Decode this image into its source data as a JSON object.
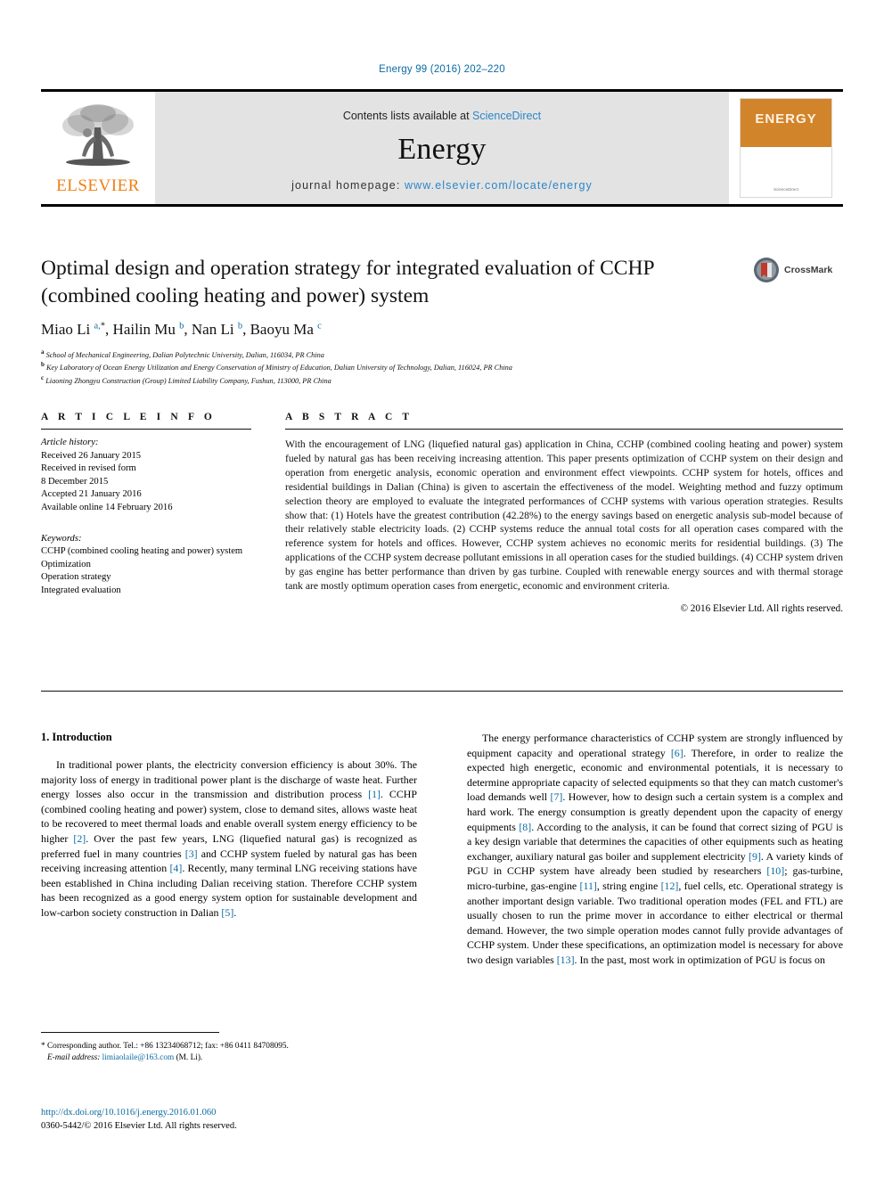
{
  "running_head": "Energy 99 (2016) 202–220",
  "masthead": {
    "contents_prefix": "Contents lists available at ",
    "sciencedirect": "ScienceDirect",
    "journal_name": "Energy",
    "homepage_prefix": "journal homepage: ",
    "homepage_url": "www.elsevier.com/locate/energy",
    "publisher_logo_text": "ELSEVIER",
    "cover_title": "ENERGY",
    "cover_footer": "ScienceDirect",
    "accent_blue": "#2a87c8",
    "elsevier_orange": "#f07f13",
    "cover_orange": "#d2842a"
  },
  "article": {
    "title": "Optimal design and operation strategy for integrated evaluation of CCHP (combined cooling heating and power) system",
    "crossmark_label": "CrossMark",
    "authors_html": "Miao Li <sup>a,</sup><sup class=\"star\">*</sup>, Hailin Mu <sup>b</sup>, Nan Li <sup>b</sup>, Baoyu Ma <sup>c</sup>",
    "affiliations": [
      {
        "marker": "a",
        "text": "School of Mechanical Engineering, Dalian Polytechnic University, Dalian, 116034, PR China"
      },
      {
        "marker": "b",
        "text": "Key Laboratory of Ocean Energy Utilization and Energy Conservation of Ministry of Education, Dalian University of Technology, Dalian, 116024, PR China"
      },
      {
        "marker": "c",
        "text": "Liaoning Zhongyu Construction (Group) Limited Liability Company, Fushun, 113000, PR China"
      }
    ]
  },
  "info": {
    "heading": "A R T I C L E  I N F O",
    "history_label": "Article history:",
    "history": [
      "Received 26 January 2015",
      "Received in revised form",
      "8 December 2015",
      "Accepted 21 January 2016",
      "Available online 14 February 2016"
    ],
    "keywords_label": "Keywords:",
    "keywords": [
      "CCHP (combined cooling heating and power) system",
      "Optimization",
      "Operation strategy",
      "Integrated evaluation"
    ]
  },
  "abstract": {
    "heading": "A B S T R A C T",
    "text": "With the encouragement of LNG (liquefied natural gas) application in China, CCHP (combined cooling heating and power) system fueled by natural gas has been receiving increasing attention. This paper presents optimization of CCHP system on their design and operation from energetic analysis, economic operation and environment effect viewpoints. CCHP system for hotels, offices and residential buildings in Dalian (China) is given to ascertain the effectiveness of the model. Weighting method and fuzzy optimum selection theory are employed to evaluate the integrated performances of CCHP systems with various operation strategies. Results show that: (1) Hotels have the greatest contribution (42.28%) to the energy savings based on energetic analysis sub-model because of their relatively stable electricity loads. (2) CCHP systems reduce the annual total costs for all operation cases compared with the reference system for hotels and offices. However, CCHP system achieves no economic merits for residential buildings. (3) The applications of the CCHP system decrease pollutant emissions in all operation cases for the studied buildings. (4) CCHP system driven by gas engine has better performance than driven by gas turbine. Coupled with renewable energy sources and with thermal storage tank are mostly optimum operation cases from energetic, economic and environment criteria.",
    "copyright": "© 2016 Elsevier Ltd. All rights reserved."
  },
  "introduction": {
    "heading": "1. Introduction",
    "left_paragraph_parts": [
      "In traditional power plants, the electricity conversion efficiency is about 30%. The majority loss of energy in traditional power plant is the discharge of waste heat. Further energy losses also occur in the transmission and distribution process ",
      "[1]",
      ". CCHP (combined cooling heating and power) system, close to demand sites, allows waste heat to be recovered to meet thermal loads and enable overall system energy efficiency to be higher ",
      "[2]",
      ". Over the past few years, LNG (liquefied natural gas) is recognized as preferred fuel in many countries ",
      "[3]",
      " and CCHP system fueled by natural gas has been receiving increasing attention ",
      "[4]",
      ". Recently, many terminal LNG receiving stations have been established in China including Dalian receiving station. Therefore CCHP system has been recognized as a good energy system option for sustainable development and low-carbon society construction in Dalian ",
      "[5]",
      "."
    ],
    "right_paragraph_parts": [
      "The energy performance characteristics of CCHP system are strongly influenced by equipment capacity and operational strategy ",
      "[6]",
      ". Therefore, in order to realize the expected high energetic, economic and environmental potentials, it is necessary to determine appropriate capacity of selected equipments so that they can match customer's load demands well ",
      "[7]",
      ". However, how to design such a certain system is a complex and hard work. The energy consumption is greatly dependent upon the capacity of energy equipments ",
      "[8]",
      ". According to the analysis, it can be found that correct sizing of PGU is a key design variable that determines the capacities of other equipments such as heating exchanger, auxiliary natural gas boiler and supplement electricity ",
      "[9]",
      ". A variety kinds of PGU in CCHP system have already been studied by researchers ",
      "[10]",
      "; gas-turbine, micro-turbine, gas-engine ",
      "[11]",
      ", string engine ",
      "[12]",
      ", fuel cells, etc. Operational strategy is another important design variable. Two traditional operation modes (FEL and FTL) are usually chosen to run the prime mover in accordance to either electrical or thermal demand. However, the two simple operation modes cannot fully provide advantages of CCHP system. Under these specifications, an optimization model is necessary for above two design variables ",
      "[13]",
      ". In the past, most work in optimization of PGU is focus on"
    ]
  },
  "footnotes": {
    "corresponding": "* Corresponding author. Tel.: +86 13234068712; fax: +86 0411 84708095.",
    "email_label": "E-mail address:",
    "email": "limiaolaile@163.com",
    "email_suffix": "(M. Li)."
  },
  "doi_block": {
    "doi_url": "http://dx.doi.org/10.1016/j.energy.2016.01.060",
    "issn_line": "0360-5442/© 2016 Elsevier Ltd. All rights reserved."
  }
}
